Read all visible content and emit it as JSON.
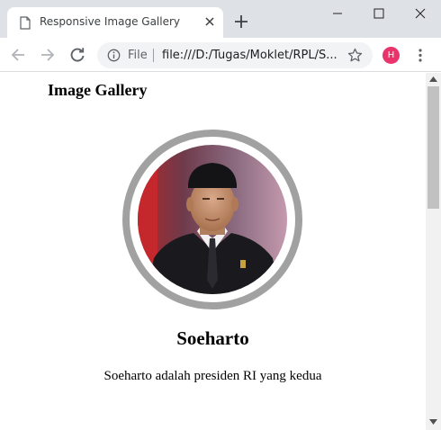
{
  "browser": {
    "tab_title": "Responsive Image Gallery",
    "address_scheme": "File",
    "address_url": "file:///D:/Tugas/Moklet/RPL/S...",
    "profile_initial": "H"
  },
  "page": {
    "heading": "Image Gallery",
    "person_name": "Soeharto",
    "person_description": "Soeharto adalah presiden RI yang kedua"
  },
  "colors": {
    "titlebar": "#dee1e6",
    "avatar": "#e8336b",
    "portrait_ring": "#a1a1a1"
  },
  "icons": [
    "page-icon",
    "close-icon",
    "plus-icon",
    "minimize-icon",
    "maximize-icon",
    "window-close-icon",
    "back-arrow-icon",
    "forward-arrow-icon",
    "reload-icon",
    "info-icon",
    "star-icon",
    "kebab-menu-icon"
  ]
}
